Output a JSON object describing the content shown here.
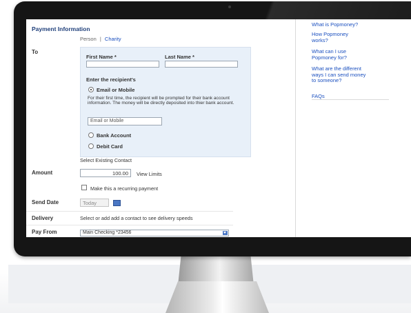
{
  "form": {
    "section_title": "Payment Information",
    "recipient_types": [
      "Person",
      "Charity"
    ],
    "separator": "|",
    "to_label": "To",
    "first_name_label": "First Name *",
    "last_name_label": "Last Name *",
    "enter_recipient_label": "Enter the recipient's",
    "email_option": "Email or Mobile",
    "email_help": "For their first time, the recipient will be prompted for their bank account information. The money will be directly deposited into thier bank account.",
    "email_placeholder": "Email or Mobile",
    "bank_option": "Bank Account",
    "debit_option": "Debit Card",
    "select_existing": "Select Existing Contact",
    "amount_label": "Amount",
    "amount_value": "100.00",
    "view_limits": "View Limits",
    "recurring_label": "Make this a recurring payment",
    "send_date_label": "Send Date",
    "send_date_value": "Today",
    "delivery_label": "Delivery",
    "delivery_text": "Select or add add a contact to see delivery speeds",
    "pay_from_label": "Pay From",
    "pay_from_value": "Main Checking *23456"
  },
  "sidebar": {
    "links": [
      "What is Popmoney?",
      "How Popmoney works?",
      "What can I use Popmoney for?",
      "What are the different ways I can send money to someone?",
      "FAQs"
    ]
  }
}
